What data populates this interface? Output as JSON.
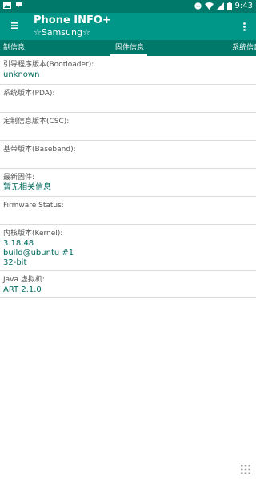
{
  "statusbar": {
    "time": "9:43"
  },
  "appbar": {
    "title": "Phone INFO+",
    "subtitle": "☆Samsung☆"
  },
  "tabs": [
    {
      "label": "制信息"
    },
    {
      "label": "固件信息"
    },
    {
      "label": "系统信息"
    }
  ],
  "items": [
    {
      "label": "引导程序版本(Bootloader):",
      "value": "unknown"
    },
    {
      "label": "系统版本(PDA):",
      "value": ""
    },
    {
      "label": "定制信息版本(CSC):",
      "value": ""
    },
    {
      "label": "基带版本(Baseband):",
      "value": ""
    },
    {
      "label": "最新固件:",
      "value": "暂无相关信息"
    },
    {
      "label": "Firmware Status:",
      "value": ""
    },
    {
      "label": "内核版本(Kernel):",
      "value": "3.18.48\nbuild@ubuntu #1\n32-bit"
    },
    {
      "label": "Java 虚拟机:",
      "value": "ART 2.1.0"
    }
  ],
  "icons": {
    "menu": "hamburger-menu-icon",
    "more": "overflow-menu-icon",
    "grid": "grid-icon"
  }
}
